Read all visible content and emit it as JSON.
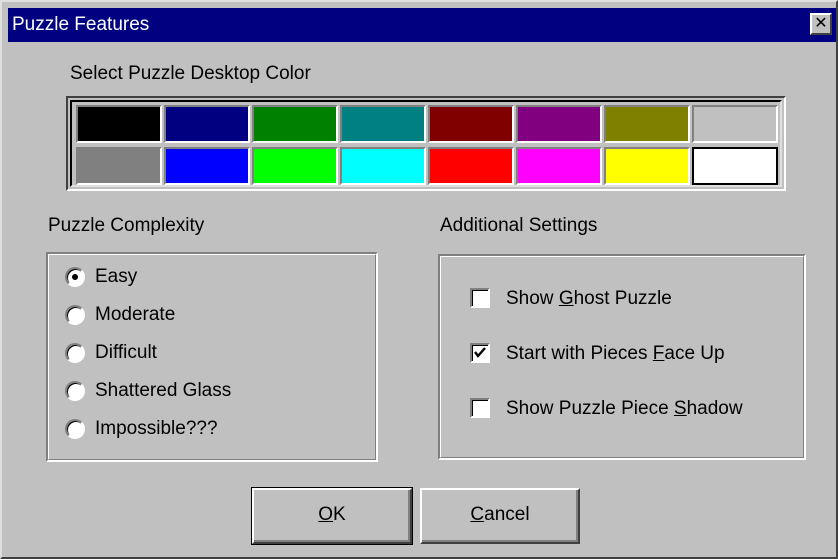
{
  "window": {
    "title": "Puzzle Features",
    "close_glyph": "✕"
  },
  "palette": {
    "label": "Select Puzzle Desktop Color",
    "colors": [
      [
        "#000000",
        "#000080",
        "#008000",
        "#008080",
        "#800000",
        "#800080",
        "#808000",
        "#c0c0c0"
      ],
      [
        "#808080",
        "#0000ff",
        "#00ff00",
        "#00ffff",
        "#ff0000",
        "#ff00ff",
        "#ffff00",
        "#ffffff"
      ]
    ],
    "selected": "#ffffff"
  },
  "complexity": {
    "label": "Puzzle Complexity",
    "options": [
      {
        "label": "Easy",
        "checked": true
      },
      {
        "label": "Moderate",
        "checked": false
      },
      {
        "label": "Difficult",
        "checked": false
      },
      {
        "label": "Shattered Glass",
        "checked": false
      },
      {
        "label": "Impossible???",
        "checked": false
      }
    ]
  },
  "settings": {
    "label": "Additional Settings",
    "options": [
      {
        "pre": "Show ",
        "mnemonic": "G",
        "post": "host Puzzle",
        "checked": false
      },
      {
        "pre": "Start with Pieces ",
        "mnemonic": "F",
        "post": "ace Up",
        "checked": true
      },
      {
        "pre": "Show Puzzle Piece ",
        "mnemonic": "S",
        "post": "hadow",
        "checked": false
      }
    ]
  },
  "buttons": {
    "ok": {
      "mnemonic": "O",
      "rest": "K"
    },
    "cancel": {
      "mnemonic": "C",
      "rest": "ancel"
    }
  }
}
